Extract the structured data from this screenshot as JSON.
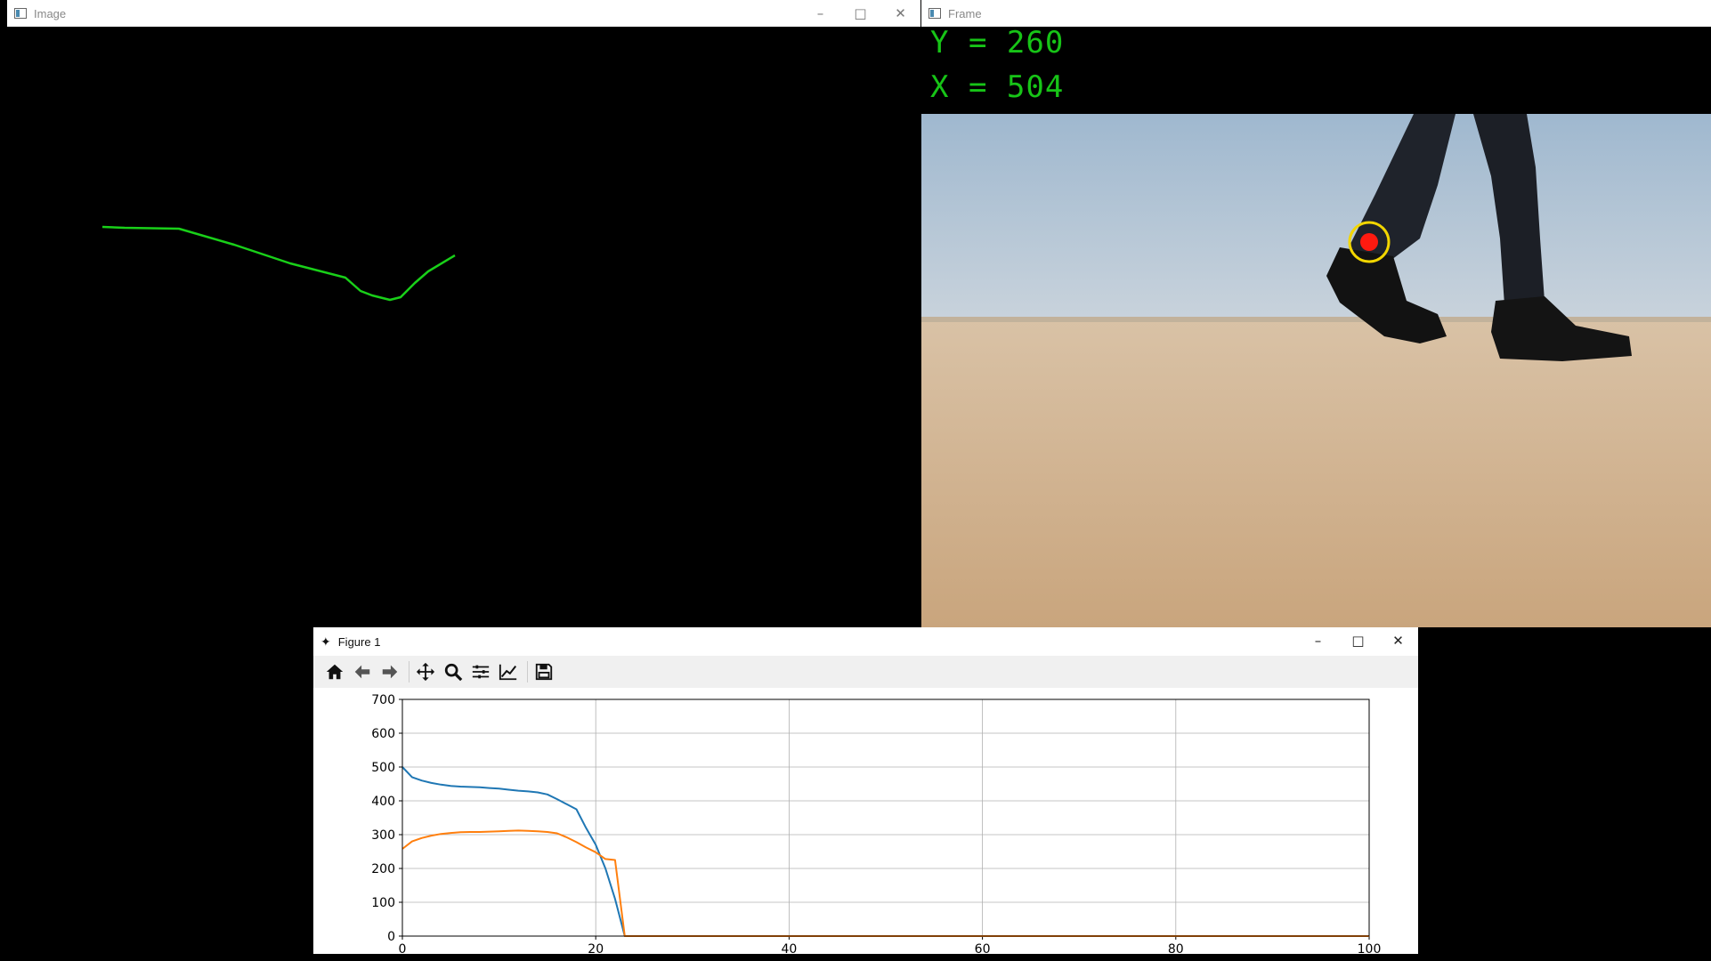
{
  "image_window": {
    "title": "Image",
    "trail_color": "#19d019"
  },
  "frame_window": {
    "title": "Frame",
    "y_readout": "Y = 260",
    "x_readout": "X = 504",
    "readout_color": "#17c417",
    "marker_outer_color": "#f2d600",
    "marker_inner_color": "#ff1a10"
  },
  "figure_window": {
    "title": "Figure 1",
    "toolbar": [
      "home-icon",
      "back-arrow-icon",
      "forward-arrow-icon",
      "pan-icon",
      "zoom-icon",
      "subplots-icon",
      "edit-curves-icon",
      "save-icon"
    ]
  },
  "chart_data": {
    "type": "line",
    "title": "",
    "xlabel": "",
    "ylabel": "",
    "xlim": [
      0,
      100
    ],
    "ylim": [
      0,
      700
    ],
    "xticks": [
      "0",
      "20",
      "40",
      "60",
      "80",
      "100"
    ],
    "yticks": [
      "0",
      "100",
      "200",
      "300",
      "400",
      "500",
      "600",
      "700"
    ],
    "grid": true,
    "series": [
      {
        "color": "#1f77b4",
        "x": [
          0,
          1,
          2,
          3,
          4,
          5,
          6,
          7,
          8,
          9,
          10,
          11,
          12,
          13,
          14,
          15,
          16,
          17,
          18,
          19,
          20,
          21,
          22,
          23,
          100
        ],
        "y": [
          500,
          470,
          460,
          453,
          448,
          444,
          442,
          441,
          440,
          438,
          436,
          433,
          430,
          428,
          425,
          419,
          405,
          390,
          375,
          320,
          270,
          200,
          110,
          0,
          0
        ]
      },
      {
        "color": "#ff7f0e",
        "x": [
          0,
          1,
          2,
          3,
          4,
          5,
          6,
          7,
          8,
          9,
          10,
          11,
          12,
          13,
          14,
          15,
          16,
          17,
          18,
          19,
          20,
          21,
          22,
          23,
          100
        ],
        "y": [
          258,
          280,
          290,
          297,
          302,
          305,
          307,
          308,
          308,
          309,
          310,
          311,
          312,
          311,
          310,
          308,
          304,
          292,
          278,
          262,
          248,
          228,
          225,
          0,
          0
        ]
      }
    ]
  }
}
